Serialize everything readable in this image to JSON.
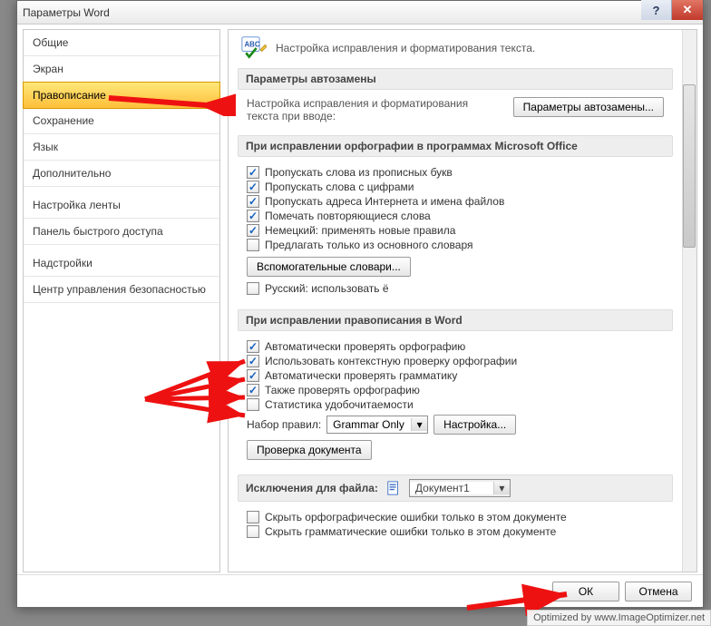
{
  "title": "Параметры Word",
  "sidebar": {
    "items": [
      {
        "label": "Общие"
      },
      {
        "label": "Экран"
      },
      {
        "label": "Правописание",
        "selected": true
      },
      {
        "label": "Сохранение"
      },
      {
        "label": "Язык"
      },
      {
        "label": "Дополнительно"
      },
      {
        "label": "Настройка ленты"
      },
      {
        "label": "Панель быстрого доступа"
      },
      {
        "label": "Надстройки"
      },
      {
        "label": "Центр управления безопасностью"
      }
    ]
  },
  "intro": "Настройка исправления и форматирования текста.",
  "sections": {
    "autocorrect": {
      "title": "Параметры автозамены",
      "text": "Настройка исправления и форматирования текста при вводе:",
      "button": "Параметры автозамены..."
    },
    "spelling_office": {
      "title": "При исправлении орфографии в программах Microsoft Office",
      "checks": [
        {
          "label": "Пропускать слова из прописных букв",
          "on": true
        },
        {
          "label": "Пропускать слова с цифрами",
          "on": true
        },
        {
          "label": "Пропускать адреса Интернета и имена файлов",
          "on": true
        },
        {
          "label": "Помечать повторяющиеся слова",
          "on": true
        },
        {
          "label": "Немецкий: применять новые правила",
          "on": true
        },
        {
          "label": "Предлагать только из основного словаря",
          "on": false
        }
      ],
      "dict_button": "Вспомогательные словари...",
      "russian_yo": {
        "label": "Русский: использовать ё",
        "on": false
      }
    },
    "spelling_word": {
      "title": "При исправлении правописания в Word",
      "checks": [
        {
          "label": "Автоматически проверять орфографию",
          "on": true
        },
        {
          "label": "Использовать контекстную проверку орфографии",
          "on": true
        },
        {
          "label": "Автоматически проверять грамматику",
          "on": true
        },
        {
          "label": "Также проверять орфографию",
          "on": true
        },
        {
          "label": "Статистика удобочитаемости",
          "on": false
        }
      ],
      "ruleset_label": "Набор правил:",
      "ruleset_value": "Grammar Only",
      "settings_btn": "Настройка...",
      "check_doc_btn": "Проверка документа"
    },
    "exclusions": {
      "title": "Исключения для файла:",
      "file": "Документ1",
      "checks": [
        {
          "label": "Скрыть орфографические ошибки только в этом документе",
          "on": false
        },
        {
          "label": "Скрыть грамматические ошибки только в этом документе",
          "on": false
        }
      ]
    }
  },
  "footer": {
    "ok": "ОК",
    "cancel": "Отмена"
  },
  "watermark": "Optimized by www.ImageOptimizer.net"
}
